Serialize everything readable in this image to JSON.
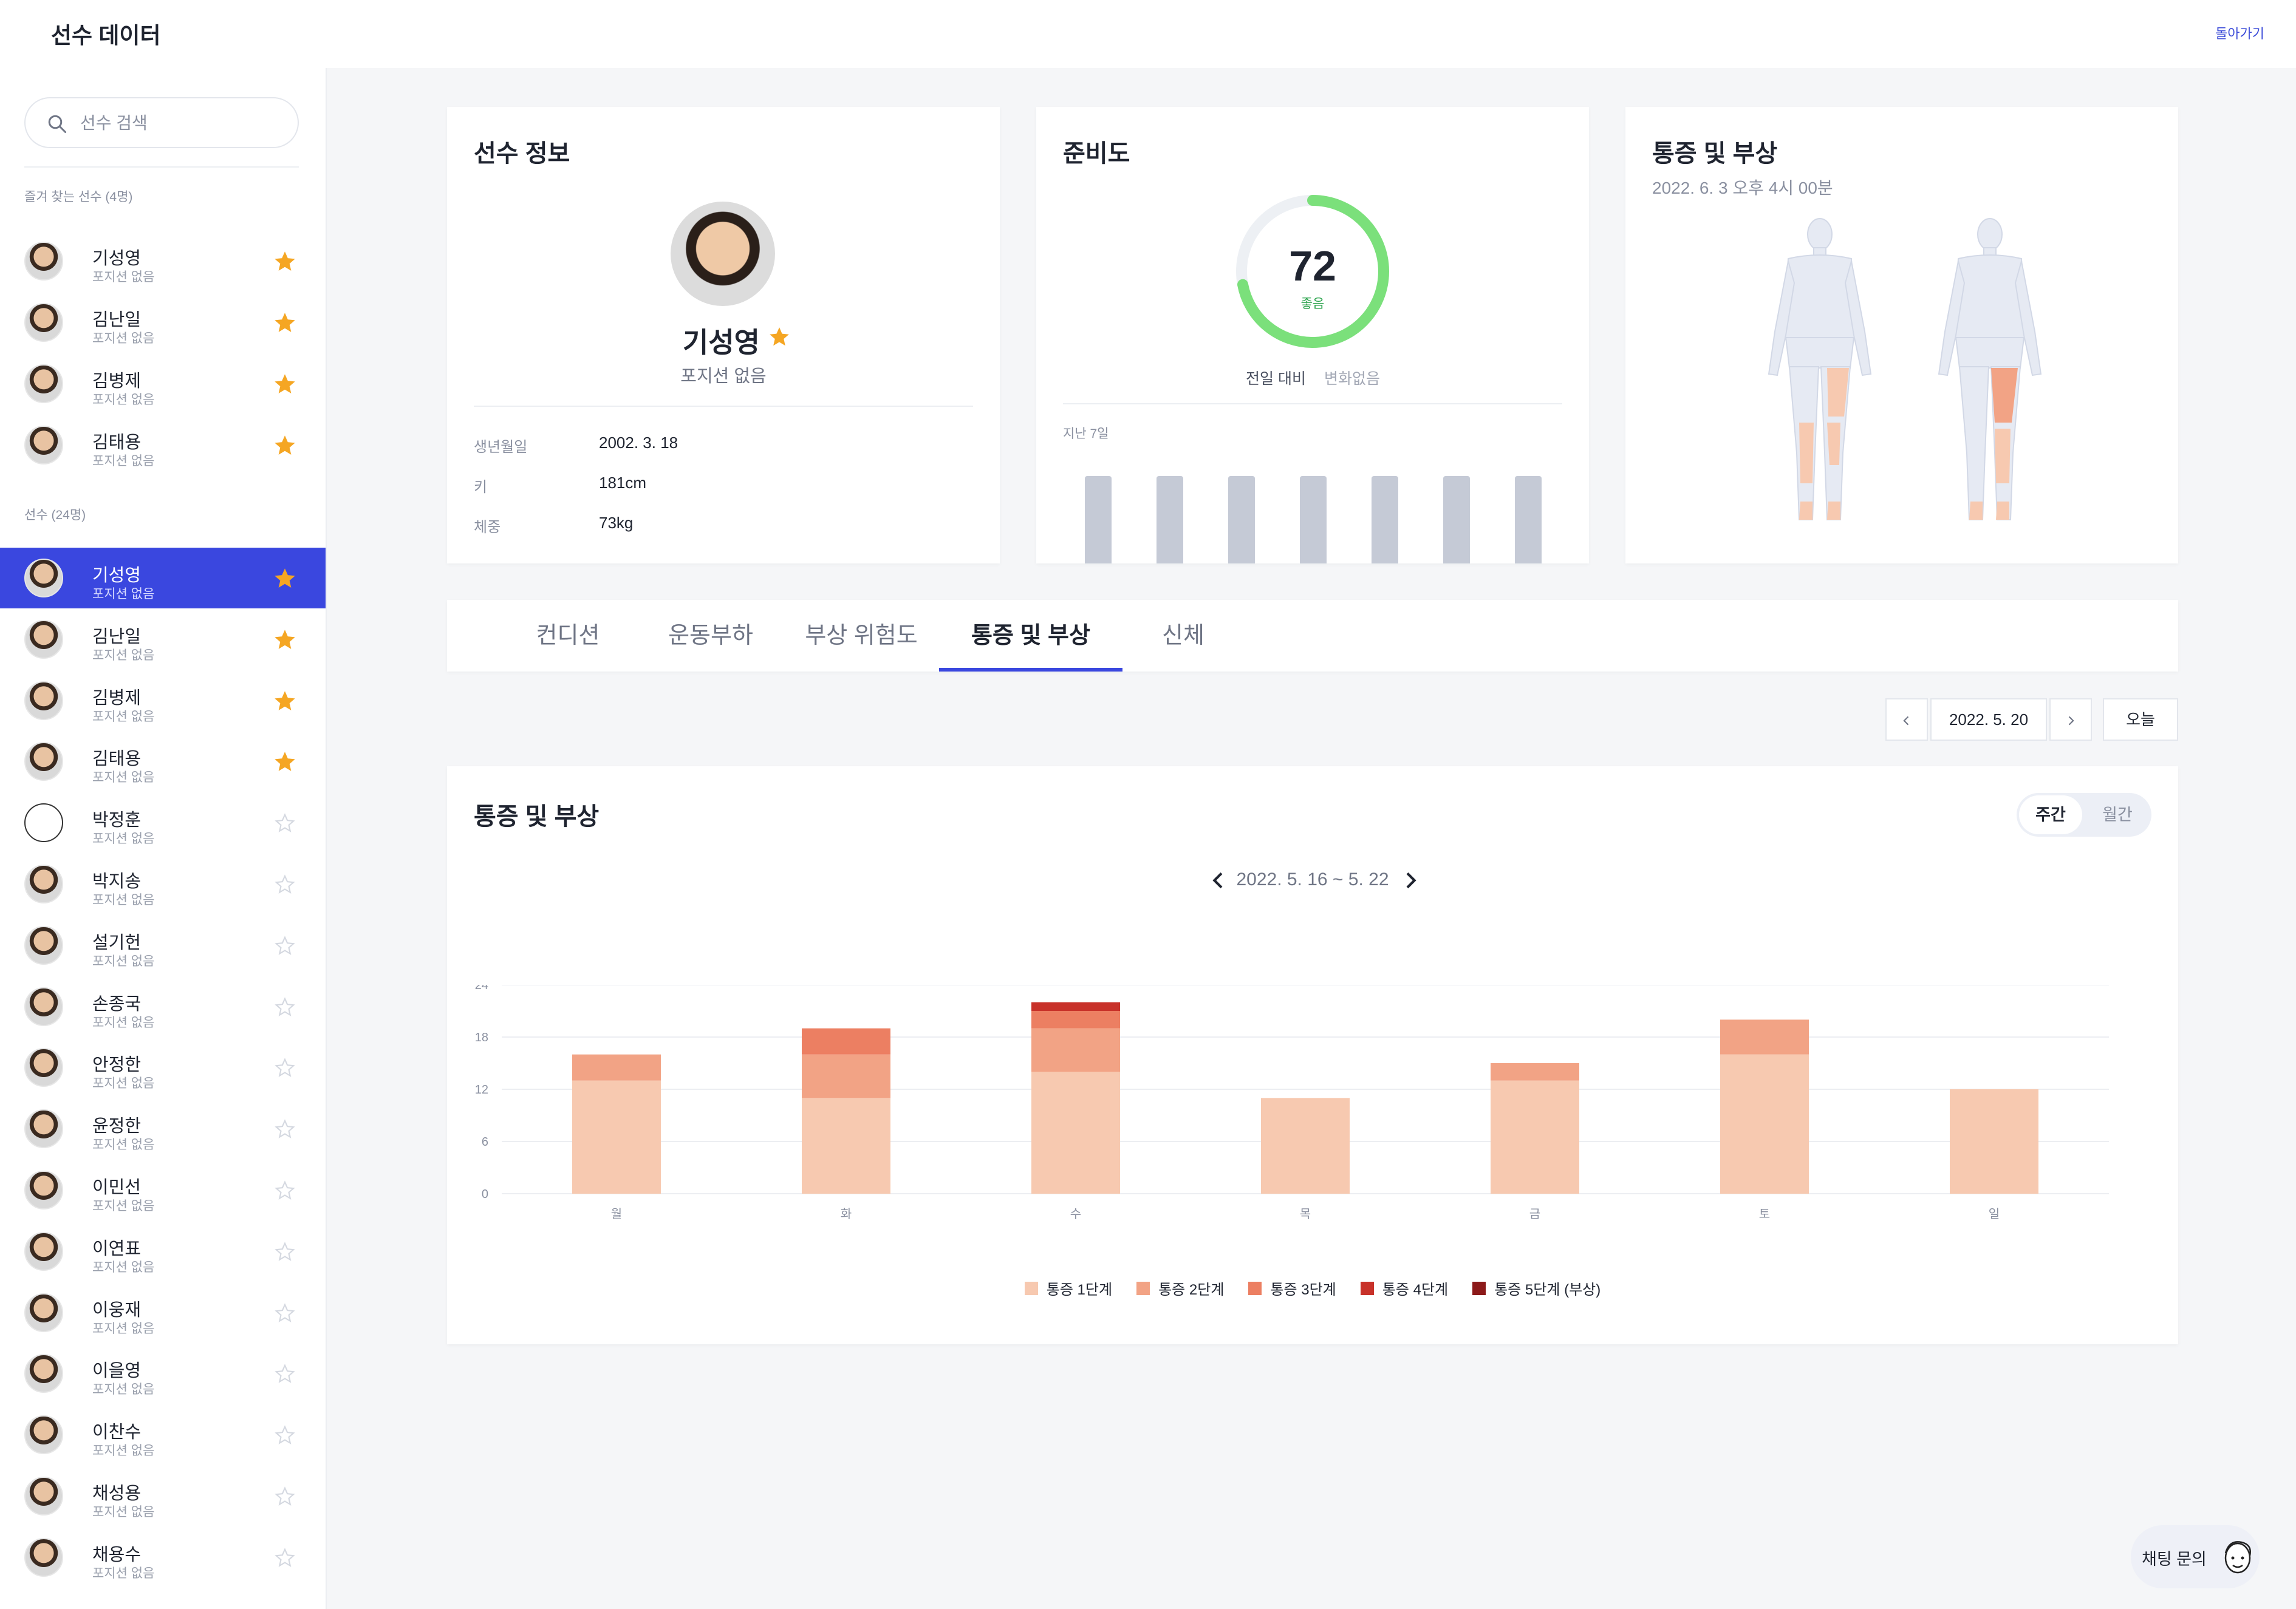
{
  "app": {
    "title": "선수 데이터",
    "back_label": "돌아가기"
  },
  "sidebar": {
    "search_placeholder": "선수 검색",
    "favorites_label": "즐겨 찾는 선수 (4명)",
    "players_label": "선수 (24명)",
    "favorites": [
      {
        "name": "기성영",
        "position": "포지션 없음"
      },
      {
        "name": "김난일",
        "position": "포지션 없음"
      },
      {
        "name": "김병제",
        "position": "포지션 없음"
      },
      {
        "name": "김태용",
        "position": "포지션 없음"
      }
    ],
    "players": [
      {
        "name": "기성영",
        "position": "포지션 없음",
        "favorite": true
      },
      {
        "name": "김난일",
        "position": "포지션 없음",
        "favorite": true
      },
      {
        "name": "김병제",
        "position": "포지션 없음",
        "favorite": true
      },
      {
        "name": "김태용",
        "position": "포지션 없음",
        "favorite": true
      },
      {
        "name": "박정훈",
        "position": "포지션 없음",
        "favorite": false
      },
      {
        "name": "박지송",
        "position": "포지션 없음",
        "favorite": false
      },
      {
        "name": "설기헌",
        "position": "포지션 없음",
        "favorite": false
      },
      {
        "name": "손종국",
        "position": "포지션 없음",
        "favorite": false
      },
      {
        "name": "안정한",
        "position": "포지션 없음",
        "favorite": false
      },
      {
        "name": "윤정한",
        "position": "포지션 없음",
        "favorite": false
      },
      {
        "name": "이민선",
        "position": "포지션 없음",
        "favorite": false
      },
      {
        "name": "이연표",
        "position": "포지션 없음",
        "favorite": false
      },
      {
        "name": "이웅재",
        "position": "포지션 없음",
        "favorite": false
      },
      {
        "name": "이을영",
        "position": "포지션 없음",
        "favorite": false
      },
      {
        "name": "이찬수",
        "position": "포지션 없음",
        "favorite": false
      },
      {
        "name": "채성용",
        "position": "포지션 없음",
        "favorite": false
      },
      {
        "name": "채용수",
        "position": "포지션 없음",
        "favorite": false
      }
    ]
  },
  "profile": {
    "title": "선수 정보",
    "name": "기성영",
    "position": "포지션 없음",
    "rows": [
      {
        "label": "생년월일",
        "value": "2002. 3. 18"
      },
      {
        "label": "키",
        "value": "181cm"
      },
      {
        "label": "체중",
        "value": "73kg"
      }
    ]
  },
  "readiness": {
    "title": "준비도",
    "score": "72",
    "score_fraction": 0.72,
    "status": "좋음",
    "compare_label": "전일 대비",
    "compare_value": "변화없음",
    "last7_label": "지난 7일"
  },
  "pain_card": {
    "title": "통증 및 부상",
    "date": "2022. 6. 3 오후 4시 00분"
  },
  "tabs": [
    "컨디션",
    "운동부하",
    "부상 위험도",
    "통증 및 부상",
    "신체"
  ],
  "active_tab": "통증 및 부상",
  "date_nav": {
    "date": "2022. 5. 20",
    "today_label": "오늘"
  },
  "chart_card": {
    "title": "통증 및 부상",
    "toggle_on": "주간",
    "toggle_off": "월간",
    "range": "2022. 5. 16 ~ 5. 22"
  },
  "colors": {
    "accent": "#3a47df",
    "pain1": "#f7c9b0",
    "pain2": "#f2a385",
    "pain3": "#ec7f62",
    "pain4": "#c8322a",
    "pain5": "#8c1a1a"
  },
  "chart_data": {
    "type": "bar",
    "stacked": true,
    "categories": [
      "월",
      "화",
      "수",
      "목",
      "금",
      "토",
      "일"
    ],
    "series": [
      {
        "name": "통증 1단계",
        "values": [
          13,
          11,
          14,
          11,
          13,
          16,
          12
        ]
      },
      {
        "name": "통증 2단계",
        "values": [
          3,
          5,
          5,
          0,
          2,
          4,
          0
        ]
      },
      {
        "name": "통증 3단계",
        "values": [
          0,
          3,
          2,
          0,
          0,
          0,
          0
        ]
      },
      {
        "name": "통증 4단계",
        "values": [
          0,
          0,
          1,
          0,
          0,
          0,
          0
        ]
      },
      {
        "name": "통증 5단계 (부상)",
        "values": [
          0,
          0,
          0,
          0,
          0,
          0,
          0
        ]
      }
    ],
    "yticks": [
      "0",
      "6",
      "12",
      "18",
      "24"
    ],
    "ylim": [
      0,
      24
    ],
    "grid": true,
    "legend": "bottom"
  },
  "chat": {
    "label": "채팅 문의"
  }
}
